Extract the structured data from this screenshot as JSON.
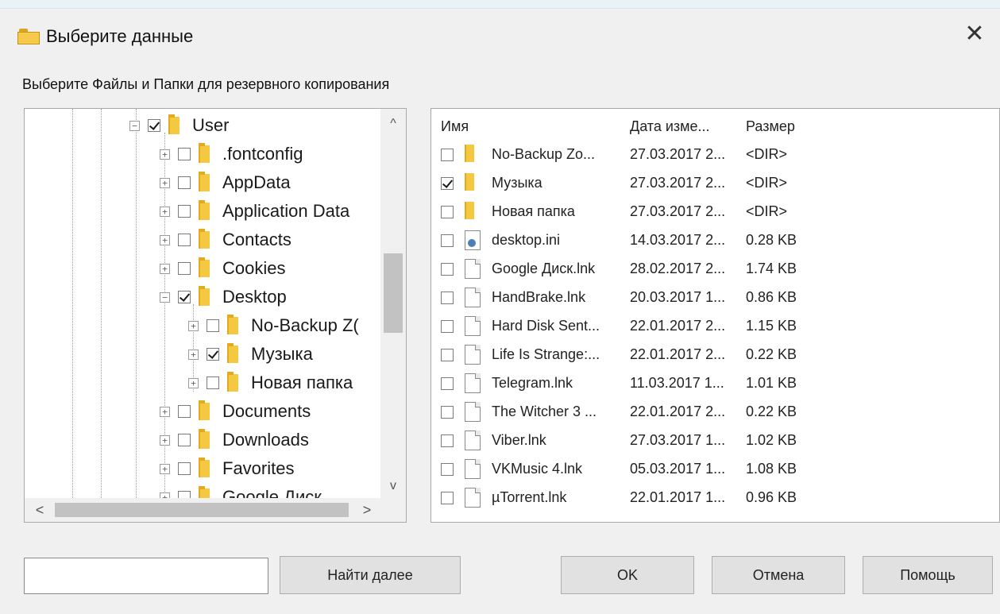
{
  "window": {
    "title": "Выберите данные",
    "close_glyph": "✕"
  },
  "instruction": "Выберите Файлы и Папки для резервного копирования",
  "tree": {
    "items": [
      {
        "label": "User",
        "checked": true
      },
      {
        "label": ".fontconfig",
        "checked": false
      },
      {
        "label": "AppData",
        "checked": false
      },
      {
        "label": "Application Data",
        "checked": false
      },
      {
        "label": "Contacts",
        "checked": false
      },
      {
        "label": "Cookies",
        "checked": false
      },
      {
        "label": "Desktop",
        "checked": true
      },
      {
        "label": "No-Backup Z(",
        "checked": false
      },
      {
        "label": "Музыка",
        "checked": true
      },
      {
        "label": "Новая папка",
        "checked": false
      },
      {
        "label": "Documents",
        "checked": false
      },
      {
        "label": "Downloads",
        "checked": false
      },
      {
        "label": "Favorites",
        "checked": false
      },
      {
        "label": "Google Диск",
        "checked": false
      }
    ],
    "scroll_up": "^",
    "scroll_down": "v",
    "scroll_left": "<",
    "scroll_right": ">"
  },
  "list": {
    "headers": {
      "name": "Имя",
      "date": "Дата изме...",
      "size": "Размер"
    },
    "rows": [
      {
        "icon": "folder",
        "name": "No-Backup Zo...",
        "date": "27.03.2017 2...",
        "size": "<DIR>",
        "checked": false
      },
      {
        "icon": "folder",
        "name": "Музыка",
        "date": "27.03.2017 2...",
        "size": "<DIR>",
        "checked": true
      },
      {
        "icon": "folder",
        "name": "Новая папка",
        "date": "27.03.2017 2...",
        "size": "<DIR>",
        "checked": false
      },
      {
        "icon": "settings-file",
        "name": "desktop.ini",
        "date": "14.03.2017 2...",
        "size": "0.28 KB",
        "checked": false
      },
      {
        "icon": "file",
        "name": "Google Диск.lnk",
        "date": "28.02.2017 2...",
        "size": "1.74 KB",
        "checked": false
      },
      {
        "icon": "file",
        "name": "HandBrake.lnk",
        "date": "20.03.2017 1...",
        "size": "0.86 KB",
        "checked": false
      },
      {
        "icon": "file",
        "name": "Hard Disk Sent...",
        "date": "22.01.2017 2...",
        "size": "1.15 KB",
        "checked": false
      },
      {
        "icon": "file",
        "name": "Life Is Strange:...",
        "date": "22.01.2017 2...",
        "size": "0.22 KB",
        "checked": false
      },
      {
        "icon": "file",
        "name": "Telegram.lnk",
        "date": "11.03.2017 1...",
        "size": "1.01 KB",
        "checked": false
      },
      {
        "icon": "file",
        "name": "The Witcher 3 ...",
        "date": "22.01.2017 2...",
        "size": "0.22 KB",
        "checked": false
      },
      {
        "icon": "file",
        "name": "Viber.lnk",
        "date": "27.03.2017 1...",
        "size": "1.02 KB",
        "checked": false
      },
      {
        "icon": "file",
        "name": "VKMusic 4.lnk",
        "date": "05.03.2017 1...",
        "size": "1.08 KB",
        "checked": false
      },
      {
        "icon": "file",
        "name": "µTorrent.lnk",
        "date": "22.01.2017 1...",
        "size": "0.96 KB",
        "checked": false
      }
    ]
  },
  "footer": {
    "search_value": "",
    "find_next": "Найти далее",
    "ok": "OK",
    "cancel": "Отмена",
    "help": "Помощь"
  }
}
